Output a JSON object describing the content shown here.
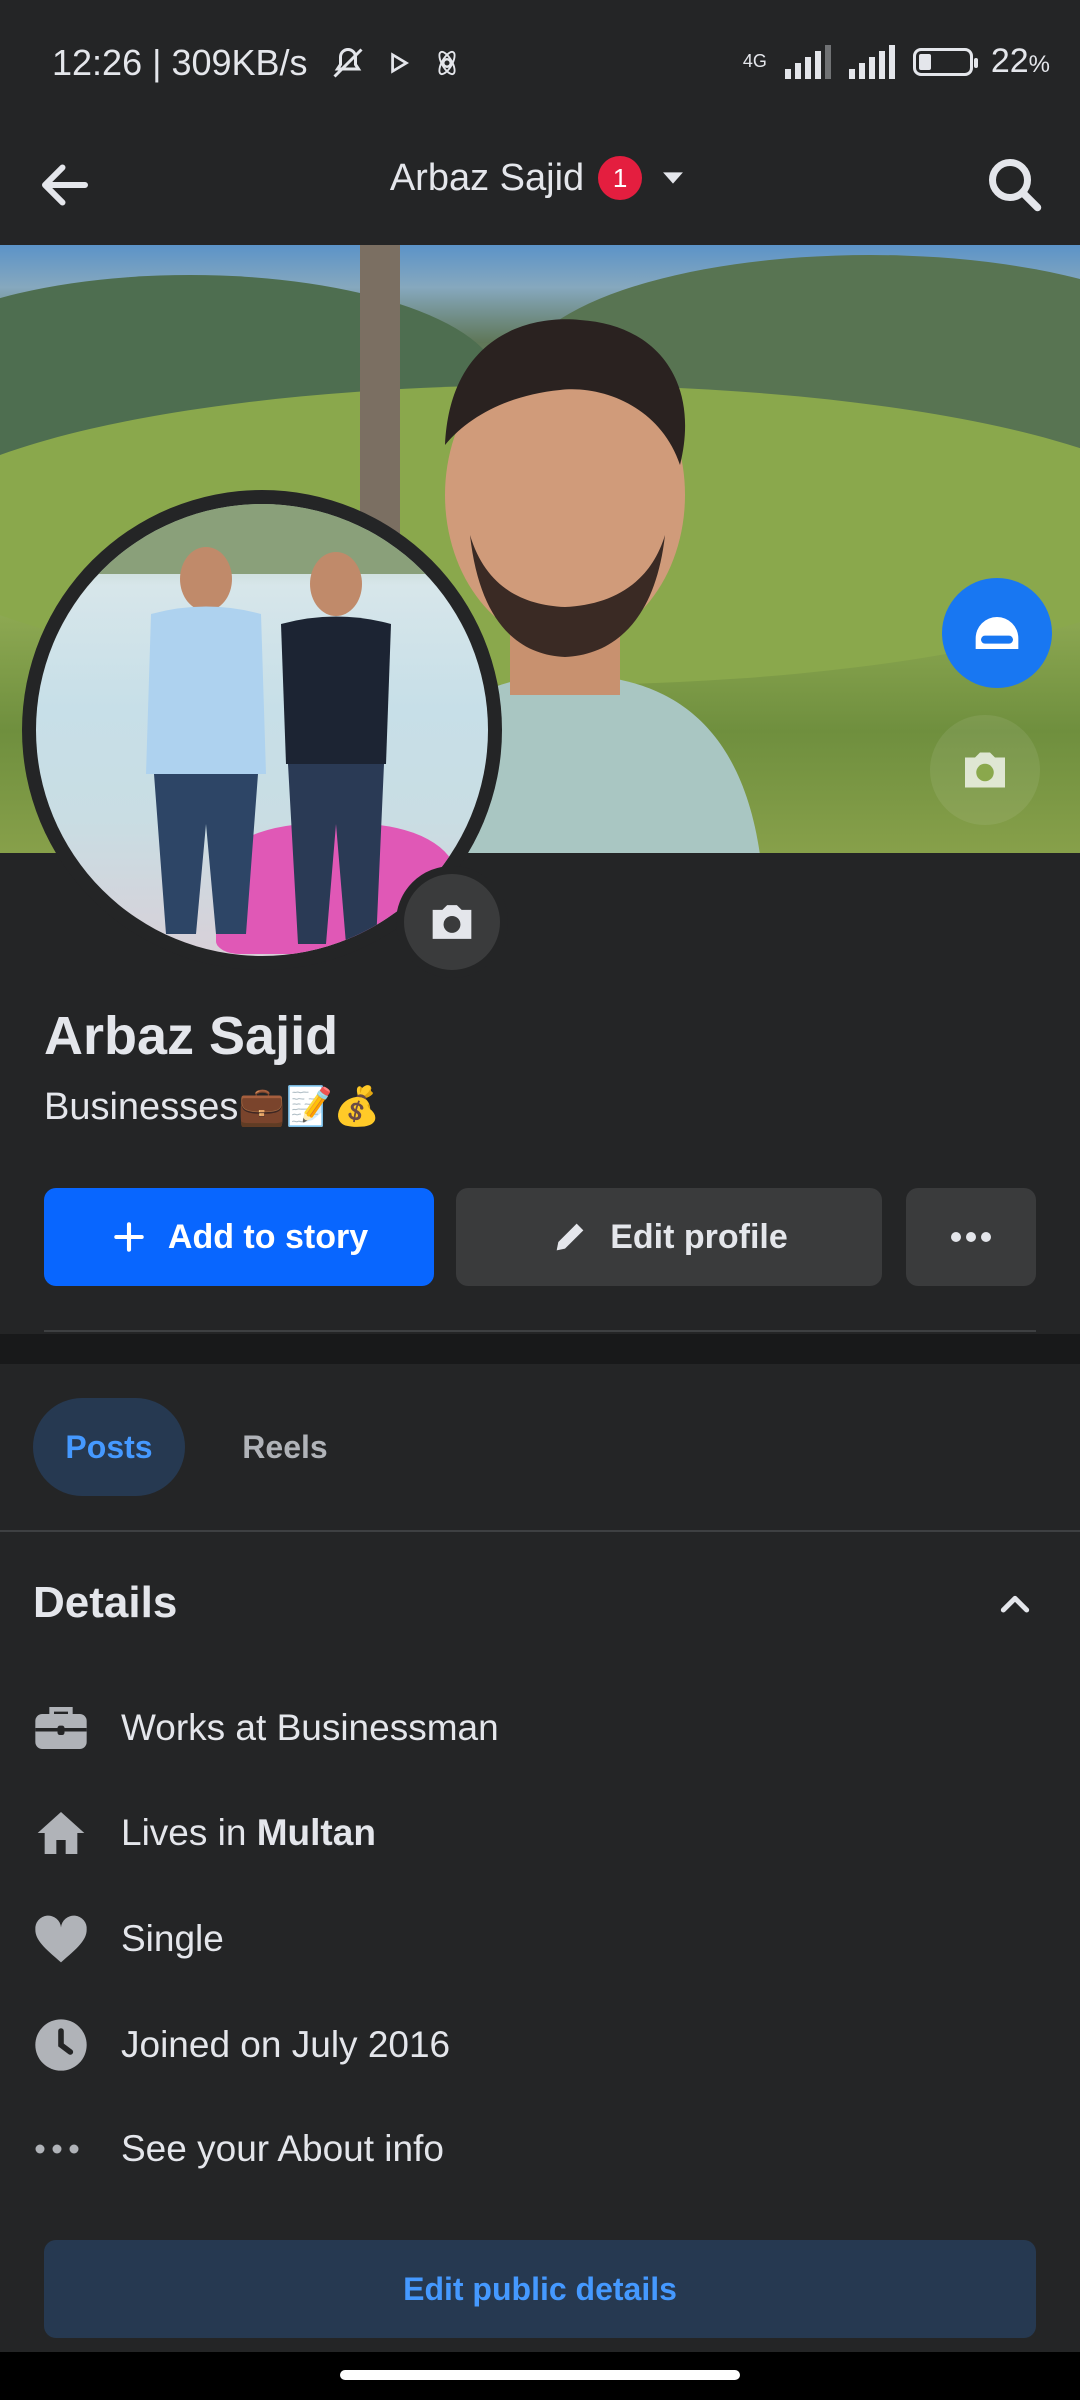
{
  "status_bar": {
    "time": "12:26",
    "speed": "309KB/s",
    "network": "4G",
    "battery": "22",
    "battery_unit": "%"
  },
  "nav": {
    "title": "Arbaz Sajid",
    "notification_count": "1"
  },
  "profile": {
    "name": "Arbaz Sajid",
    "bio": "Businesses💼📝💰"
  },
  "actions": {
    "add_story_label": "Add to story",
    "edit_profile_label": "Edit profile"
  },
  "tabs": [
    {
      "label": "Posts",
      "active": true
    },
    {
      "label": "Reels",
      "active": false
    }
  ],
  "details": {
    "title": "Details",
    "works_at": "Works at Businessman",
    "lives_prefix": "Lives in ",
    "lives_city": "Multan",
    "relationship": "Single",
    "joined": "Joined on July 2016",
    "about": "See your About info",
    "edit_public_label": "Edit public details"
  },
  "colors": {
    "background": "#242526",
    "primary_blue": "#0866ff",
    "secondary_button": "#3a3b3c",
    "link_blue": "#4599ff",
    "tab_active_bg": "#263951",
    "badge_red": "#e41e3f"
  },
  "icons": [
    "back-arrow-icon",
    "dropdown-caret-icon",
    "search-icon",
    "camera-icon",
    "bot-avatar-icon",
    "plus-icon",
    "pencil-icon",
    "more-dots-icon",
    "chevron-up-icon",
    "briefcase-icon",
    "home-icon",
    "heart-icon",
    "clock-icon"
  ]
}
